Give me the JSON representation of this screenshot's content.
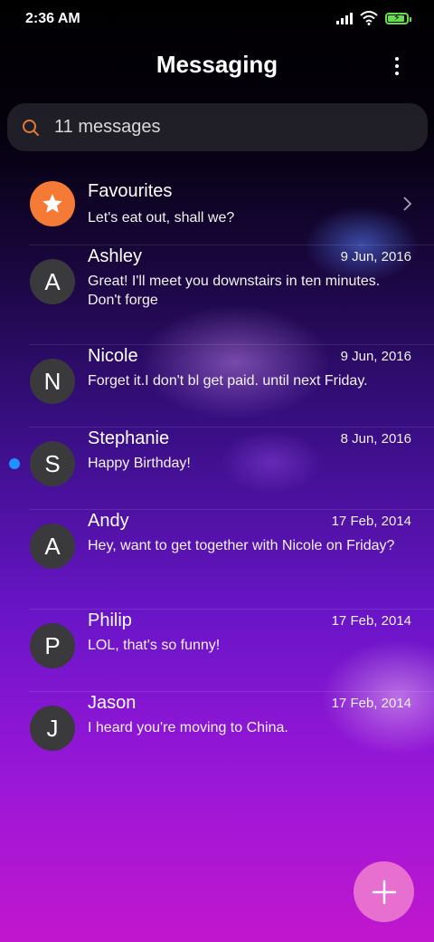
{
  "status_bar": {
    "time": "2:36 AM",
    "icons": [
      "signal-icon",
      "wifi-icon",
      "battery-charging-icon"
    ]
  },
  "header": {
    "title": "Messaging",
    "menu_icon": "more-vert-icon"
  },
  "search": {
    "text": "11 messages",
    "icon": "search-icon"
  },
  "favourites": {
    "name": "Favourites",
    "snippet": "Let's eat out, shall we?",
    "icon": "star-icon"
  },
  "conversations": [
    {
      "initial": "A",
      "name": "Ashley",
      "date": "9 Jun, 2016",
      "snippet": "Great! I'll meet you downstairs in ten minutes. Don't forge",
      "unread": false
    },
    {
      "initial": "N",
      "name": "Nicole",
      "date": "9 Jun, 2016",
      "snippet": "Forget it.I don't bl get paid. until next Friday.",
      "unread": false
    },
    {
      "initial": "S",
      "name": "Stephanie",
      "date": "8 Jun, 2016",
      "snippet": "Happy Birthday!",
      "unread": true
    },
    {
      "initial": "A",
      "name": "Andy",
      "date": "17 Feb, 2014",
      "snippet": "Hey, want to get together with Nicole on Friday?",
      "unread": false
    },
    {
      "initial": "P",
      "name": "Philip",
      "date": "17 Feb, 2014",
      "snippet": "LOL, that's so funny!",
      "unread": false
    },
    {
      "initial": "J",
      "name": "Jason",
      "date": "17 Feb, 2014",
      "snippet": "I heard you're moving to China.",
      "unread": false
    }
  ],
  "fab": {
    "icon": "plus-icon"
  },
  "colors": {
    "accent": "#f57a35",
    "fab": "#e66fd0",
    "unread_dot": "#1e90ff"
  }
}
